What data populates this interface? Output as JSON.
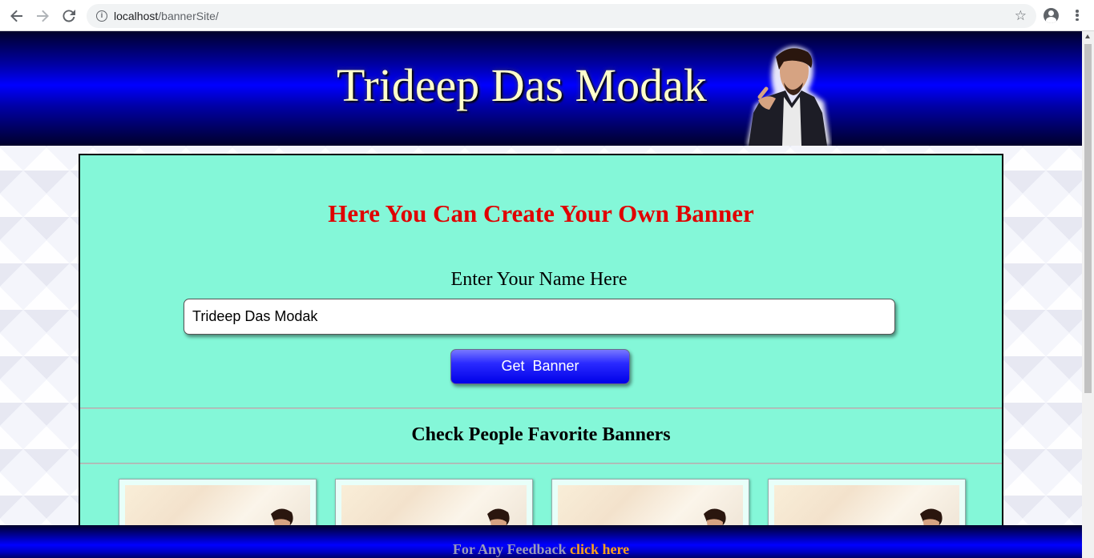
{
  "browser": {
    "url_host": "localhost",
    "url_path": "/bannerSite/"
  },
  "header": {
    "title": "Trideep Das Modak"
  },
  "main": {
    "headline": "Here You Can Create Your Own Banner",
    "name_label": "Enter Your Name Here",
    "name_input_value": "Trideep Das Modak",
    "get_banner_label": "Get  Banner",
    "favorites_title": "Check People Favorite Banners"
  },
  "footer": {
    "text": "For Any Feedback",
    "link_text": "click here"
  }
}
